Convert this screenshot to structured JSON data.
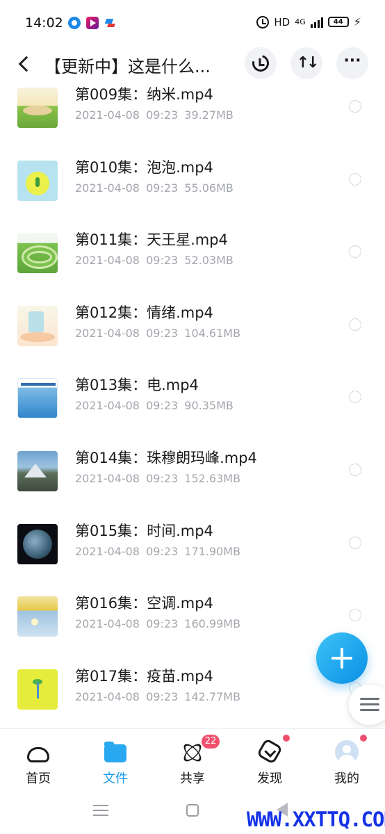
{
  "status_bar": {
    "time": "14:02",
    "hd_label": "HD",
    "network_label": "4G",
    "battery_level": "44"
  },
  "header": {
    "title": "【更新中】这是什么..."
  },
  "files": [
    {
      "name": "第009集：纳米.mp4",
      "date": "2021-04-08",
      "time": "09:23",
      "size": "39.27MB",
      "thumb": "t-009"
    },
    {
      "name": "第010集：泡泡.mp4",
      "date": "2021-04-08",
      "time": "09:23",
      "size": "55.06MB",
      "thumb": "t-010"
    },
    {
      "name": "第011集：天王星.mp4",
      "date": "2021-04-08",
      "time": "09:23",
      "size": "52.03MB",
      "thumb": "t-011"
    },
    {
      "name": "第012集：情绪.mp4",
      "date": "2021-04-08",
      "time": "09:23",
      "size": "104.61MB",
      "thumb": "t-012"
    },
    {
      "name": "第013集：电.mp4",
      "date": "2021-04-08",
      "time": "09:23",
      "size": "90.35MB",
      "thumb": "t-013"
    },
    {
      "name": "第014集：珠穆朗玛峰.mp4",
      "date": "2021-04-08",
      "time": "09:23",
      "size": "152.63MB",
      "thumb": "t-014"
    },
    {
      "name": "第015集：时间.mp4",
      "date": "2021-04-08",
      "time": "09:23",
      "size": "171.90MB",
      "thumb": "t-015"
    },
    {
      "name": "第016集：空调.mp4",
      "date": "2021-04-08",
      "time": "09:23",
      "size": "160.99MB",
      "thumb": "t-016"
    },
    {
      "name": "第017集：疫苗.mp4",
      "date": "2021-04-08",
      "time": "09:23",
      "size": "142.77MB",
      "thumb": "t-017"
    }
  ],
  "bottom_nav": {
    "items": [
      {
        "label": "首页",
        "icon": "cloud-home-icon"
      },
      {
        "label": "文件",
        "icon": "folder-icon",
        "active": true
      },
      {
        "label": "共享",
        "icon": "share-atom-icon",
        "badge": "22"
      },
      {
        "label": "发现",
        "icon": "discover-box-icon",
        "dot": true
      },
      {
        "label": "我的",
        "icon": "avatar-icon",
        "dot": true
      }
    ]
  },
  "watermark": "WWW.XXTTQ.COM",
  "colors": {
    "accent": "#1a9be8",
    "badge": "#f0506e",
    "meta_text": "#a3a6ad",
    "watermark": "#1633e8"
  }
}
